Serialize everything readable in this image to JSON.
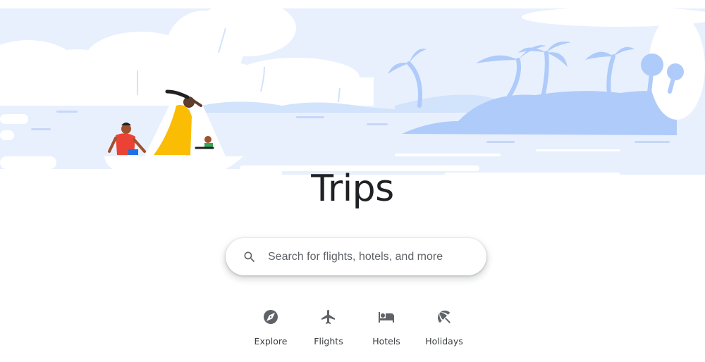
{
  "page": {
    "title": "Trips"
  },
  "search": {
    "placeholder": "Search for flights, hotels, and more",
    "icon": "search-icon"
  },
  "nav": {
    "items": [
      {
        "label": "Explore",
        "icon": "compass-icon"
      },
      {
        "label": "Flights",
        "icon": "airplane-icon"
      },
      {
        "label": "Hotels",
        "icon": "bed-icon"
      },
      {
        "label": "Holidays",
        "icon": "beach-umbrella-icon"
      }
    ]
  },
  "colors": {
    "sky": "#e8f0fe",
    "water": "#d2e3fc",
    "island": "#aecbfa",
    "title_text": "#202124",
    "icon_gray": "#5f6368"
  }
}
